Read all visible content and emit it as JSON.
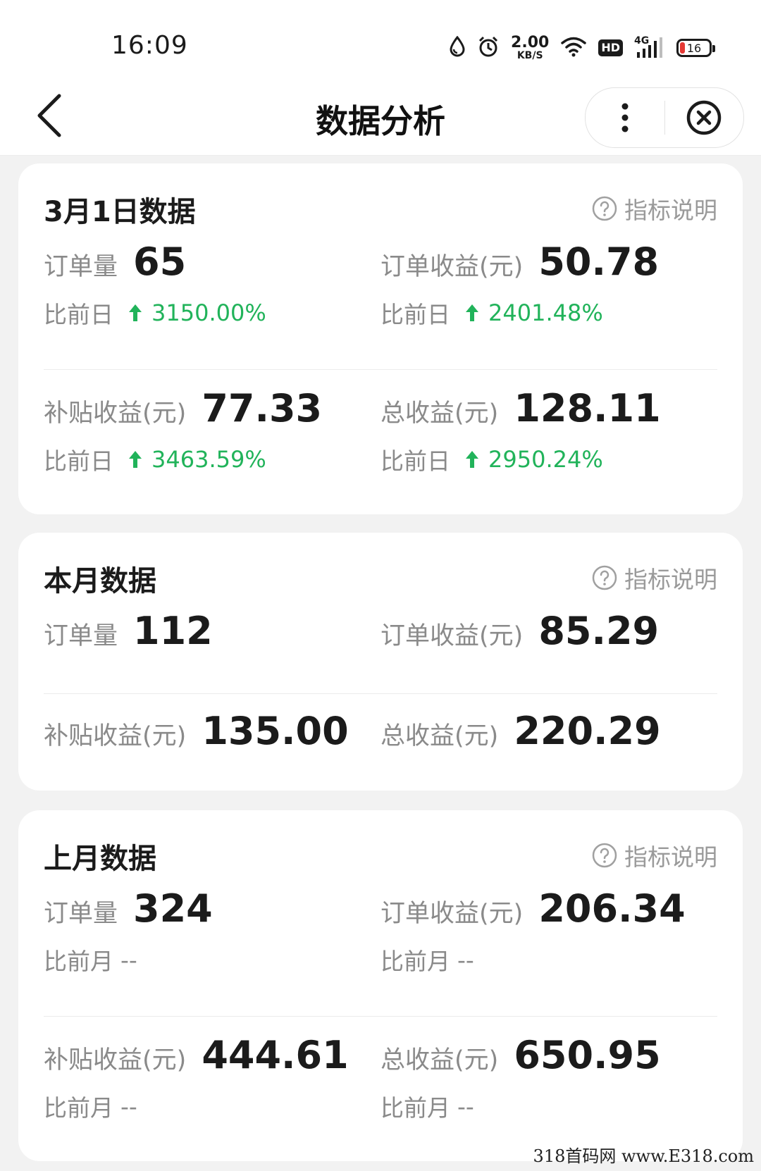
{
  "status_bar": {
    "time": "16:09",
    "net_speed_value": "2.00",
    "net_speed_unit": "KB/S",
    "hd": "HD",
    "signal": "4G",
    "battery": "16",
    "battery_color": "#e53935"
  },
  "header": {
    "title": "数据分析"
  },
  "cards": [
    {
      "title": "3月1日数据",
      "help": "指标说明",
      "order_count_label": "订单量",
      "order_count": "65",
      "order_income_label": "订单收益(元)",
      "order_income": "50.78",
      "cmp1_label": "比前日",
      "cmp1_value": "3150.00%",
      "cmp2_label": "比前日",
      "cmp2_value": "2401.48%",
      "subsidy_label": "补贴收益(元)",
      "subsidy": "77.33",
      "total_label": "总收益(元)",
      "total": "128.11",
      "cmp3_label": "比前日",
      "cmp3_value": "3463.59%",
      "cmp4_label": "比前日",
      "cmp4_value": "2950.24%"
    },
    {
      "title": "本月数据",
      "help": "指标说明",
      "order_count_label": "订单量",
      "order_count": "112",
      "order_income_label": "订单收益(元)",
      "order_income": "85.29",
      "subsidy_label": "补贴收益(元)",
      "subsidy": "135.00",
      "total_label": "总收益(元)",
      "total": "220.29"
    },
    {
      "title": "上月数据",
      "help": "指标说明",
      "order_count_label": "订单量",
      "order_count": "324",
      "order_income_label": "订单收益(元)",
      "order_income": "206.34",
      "cmp1_label": "比前月",
      "cmp1_value": "--",
      "cmp2_label": "比前月",
      "cmp2_value": "--",
      "subsidy_label": "补贴收益(元)",
      "subsidy": "444.61",
      "total_label": "总收益(元)",
      "total": "650.95",
      "cmp3_label": "比前月",
      "cmp3_value": "--",
      "cmp4_label": "比前月",
      "cmp4_value": "--"
    }
  ],
  "colors": {
    "increase": "#21b35a",
    "label": "#8a8a8a",
    "value": "#1b1b1b"
  },
  "watermark": "318首码网 www.E318.com"
}
